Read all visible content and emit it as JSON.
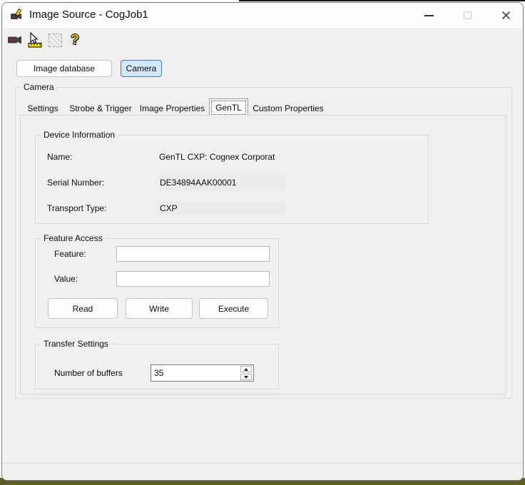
{
  "window": {
    "title": "Image Source - CogJob1",
    "icons": {
      "app": "camera-pencil-icon",
      "minimize": "minimize-icon",
      "maximize": "maximize-icon",
      "close": "close-icon"
    },
    "close_glyph": "✕"
  },
  "toolbar": {
    "icons": [
      "video-camera-icon",
      "pointer-ruler-icon",
      "image-grid-disabled-icon",
      "help-icon"
    ],
    "help_glyph": "?"
  },
  "source_selector": {
    "image_database_label": "Image database",
    "camera_label": "Camera"
  },
  "camera_group_label": "Camera",
  "tab_strip": {
    "selected": "GenTL",
    "tabs": [
      {
        "label": "Settings"
      },
      {
        "label": "Strobe & Trigger"
      },
      {
        "label": "Image Properties"
      },
      {
        "label": "GenTL"
      },
      {
        "label": "Custom Properties"
      }
    ]
  },
  "device_information": {
    "title": "Device Information",
    "name_label": "Name:",
    "name_value": "GenTL CXP: Cognex Corporat",
    "serial_label": "Serial Number:",
    "serial_value": "DE34894AAK00001",
    "transport_label": "Transport Type:",
    "transport_value": "CXP"
  },
  "feature_access": {
    "title": "Feature Access",
    "feature_label": "Feature:",
    "feature_value": "",
    "value_label": "Value:",
    "value_value": "",
    "read_label": "Read",
    "write_label": "Write",
    "execute_label": "Execute"
  },
  "transfer_settings": {
    "title": "Transfer Settings",
    "buffers_label": "Number of buffers",
    "buffers_value": "35"
  },
  "colors": {
    "panel_bg": "#f0f0f0",
    "titlebar_bg": "#fdfdfd",
    "selected_button_bg": "#d3e8fb",
    "selected_button_border": "#3d78af",
    "readonly_field_bg": "#ececec",
    "toolbar_help_yellow": "#e9c400",
    "desktop_edge_olive": "#5d5f22"
  }
}
